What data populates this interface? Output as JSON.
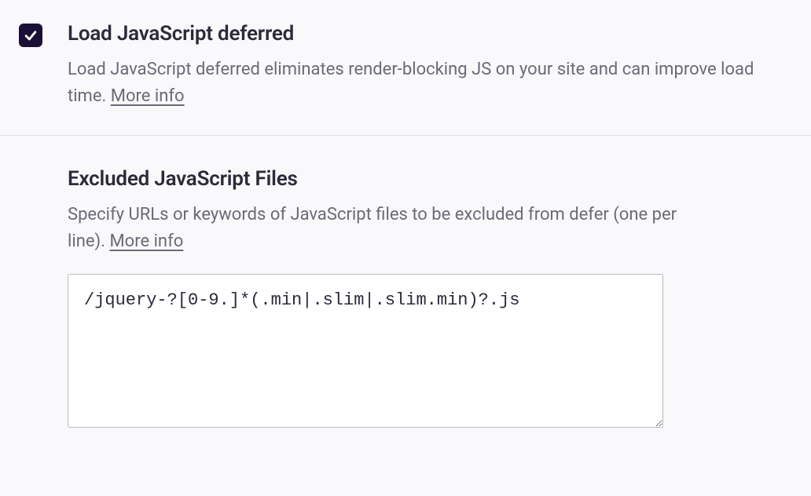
{
  "defer": {
    "title": "Load JavaScript deferred",
    "description": "Load JavaScript deferred eliminates render-blocking JS on your site and can improve load time. ",
    "more_info": "More info",
    "checked": true
  },
  "exclude": {
    "title": "Excluded JavaScript Files",
    "description": "Specify URLs or keywords of JavaScript files to be excluded from defer (one per line). ",
    "more_info": "More info",
    "value": "/jquery-?[0-9.]*(.min|.slim|.slim.min)?.js"
  }
}
